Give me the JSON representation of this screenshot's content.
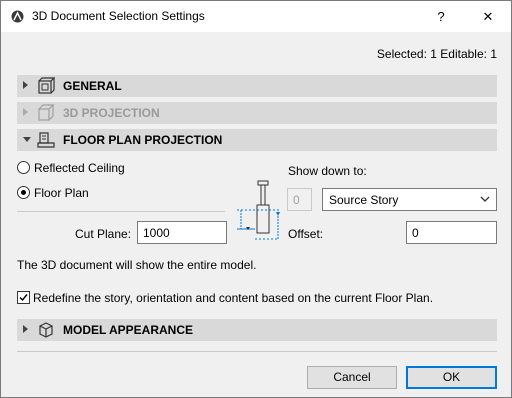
{
  "window": {
    "title": "3D Document Selection Settings",
    "help_label": "?",
    "close_label": "✕",
    "selected_info": "Selected: 1 Editable: 1"
  },
  "sections": {
    "general": {
      "label": "GENERAL",
      "expanded": false,
      "enabled": true
    },
    "projection_3d": {
      "label": "3D PROJECTION",
      "expanded": false,
      "enabled": false
    },
    "floor_plan": {
      "label": "FLOOR PLAN PROJECTION",
      "expanded": true,
      "enabled": true
    },
    "model_appearance": {
      "label": "MODEL APPEARANCE",
      "expanded": false,
      "enabled": true
    }
  },
  "floor_plan": {
    "reflected_ceiling_label": "Reflected Ceiling",
    "reflected_ceiling_checked": false,
    "floor_plan_label": "Floor Plan",
    "floor_plan_checked": true,
    "show_down_to_label": "Show down to:",
    "show_down_value": "0",
    "show_down_option": "Source Story",
    "cut_plane_label": "Cut Plane:",
    "cut_plane_value": "1000",
    "offset_label": "Offset:",
    "offset_value": "0",
    "info_text": "The 3D document will show the entire model.",
    "redefine_label": "Redefine the story, orientation and content based on the current Floor Plan.",
    "redefine_checked": true
  },
  "buttons": {
    "cancel": "Cancel",
    "ok": "OK"
  },
  "colors": {
    "section_bg": "#d9d9d9",
    "accent": "#0078d7"
  }
}
